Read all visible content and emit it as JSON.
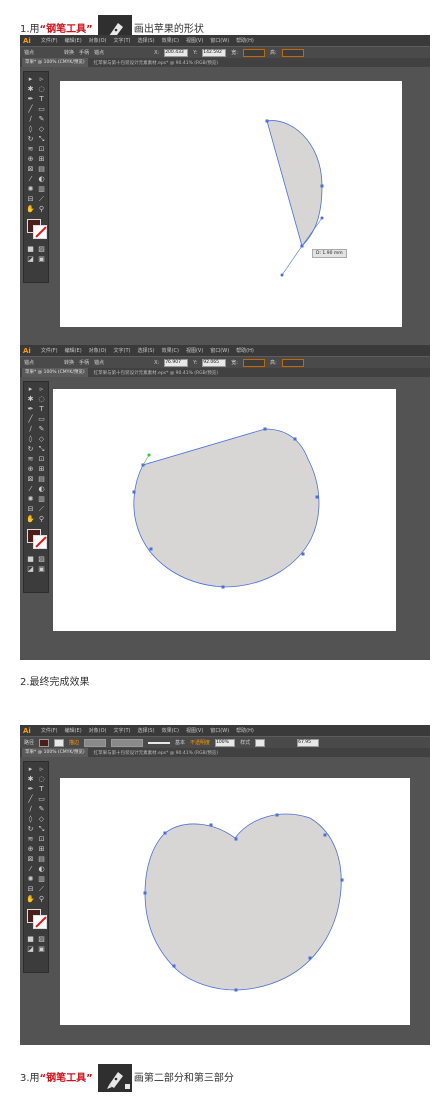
{
  "step1": {
    "number": "1.用",
    "highlight": "“钢笔工具”",
    "rest": "画出苹果的形状"
  },
  "step2": {
    "text": "2.最终完成效果"
  },
  "step3": {
    "number": "3.用",
    "highlight": "“钢笔工具”",
    "rest": "画第二部分和第三部分"
  },
  "app": {
    "logo": "Ai",
    "menus": [
      "文件(F)",
      "编辑(E)",
      "对象(O)",
      "文字(T)",
      "选择(S)",
      "效果(C)",
      "视图(V)",
      "窗口(W)",
      "帮助(H)"
    ],
    "ctrl_label_anchor": "锚点",
    "ctrl_label_path": "路径",
    "ctrl_convert": "转换",
    "ctrl_handle": "手柄",
    "ctrl_anchor": "锚点",
    "ctrl_x": "X:",
    "ctrl_y": "Y:",
    "ctrl_w": "宽:",
    "ctrl_h": "高:",
    "ctrl_x_value": "200.433",
    "ctrl_y_value": "142.592",
    "ctrl_x_value2": "76.907",
    "ctrl_y_value2": "92.065",
    "ctrl_w_value": "0 mm",
    "ctrl_h_value": "0 mm",
    "ctrl_stroke_label": "描边",
    "ctrl_stroke_size": "基本",
    "ctrl_opacity_label": "不透明度",
    "ctrl_opacity": "100%",
    "ctrl_style_label": "样式",
    "ctrl_doc_value": "67.95",
    "tab_left": "苹果* @ 100% (CMYK/预览)",
    "tab_right": "红苹果与第十包装设计元素素材.eps* @ 90.41% (RGB/预览)",
    "measure_label": "D: 1.90 mm",
    "accent_orange": "#ff9a00",
    "fill_color": "#4a1e1b",
    "shape_fill": "#d8d6d4",
    "path_color": "#4a6fd8"
  }
}
